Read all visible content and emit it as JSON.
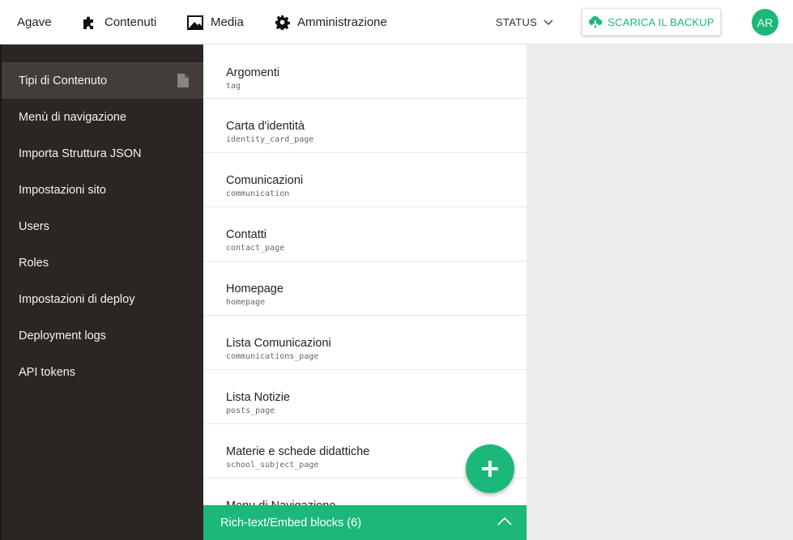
{
  "topbar": {
    "brand": "Agave",
    "nav": [
      {
        "label": "Contenuti",
        "icon": "puzzle-icon"
      },
      {
        "label": "Media",
        "icon": "image-icon"
      },
      {
        "label": "Amministrazione",
        "icon": "gear-icon"
      }
    ],
    "status_label": "STATUS",
    "backup_label": "SCARICA IL BACKUP",
    "avatar_initials": "AR"
  },
  "sidebar": {
    "items": [
      {
        "label": "Tipi di Contenuto",
        "active": true
      },
      {
        "label": "Menù di navigazione"
      },
      {
        "label": "Importa Struttura JSON"
      },
      {
        "label": "Impostazioni sito"
      },
      {
        "label": "Users"
      },
      {
        "label": "Roles"
      },
      {
        "label": "Impostazioni di deploy"
      },
      {
        "label": "Deployment logs"
      },
      {
        "label": "API tokens"
      }
    ]
  },
  "content_types": [
    {
      "title": "Argomenti",
      "slug": "tag"
    },
    {
      "title": "Carta d'identità",
      "slug": "identity_card_page"
    },
    {
      "title": "Comunicazioni",
      "slug": "communication"
    },
    {
      "title": "Contatti",
      "slug": "contact_page"
    },
    {
      "title": "Homepage",
      "slug": "homepage"
    },
    {
      "title": "Lista Comunicazioni",
      "slug": "communications_page"
    },
    {
      "title": "Lista Notizie",
      "slug": "posts_page"
    },
    {
      "title": "Materie e schede didattiche",
      "slug": "school_subject_page"
    },
    {
      "title": "Menu di Navigazione",
      "slug": ""
    }
  ],
  "blocks_bar": {
    "label": "Rich-text/Embed blocks (6)"
  },
  "colors": {
    "accent": "#1bb87a",
    "sidebar_bg": "#2b2624",
    "sidebar_active": "#433d3a"
  }
}
